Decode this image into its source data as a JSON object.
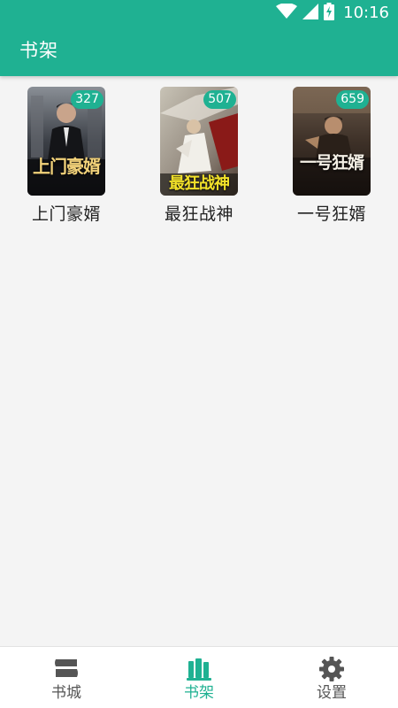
{
  "status_bar": {
    "time": "10:16",
    "icons": [
      "wifi-icon",
      "cellular-signal-icon",
      "battery-charging-icon"
    ]
  },
  "app_bar": {
    "title": "书架"
  },
  "shelf": {
    "books": [
      {
        "title": "上门豪婿",
        "badge": "327",
        "cover_text": "上门豪婿"
      },
      {
        "title": "最狂战神",
        "badge": "507",
        "cover_text": "最狂战神"
      },
      {
        "title": "一号狂婿",
        "badge": "659",
        "cover_text": "一号狂婿"
      }
    ]
  },
  "bottom_nav": {
    "items": [
      {
        "label": "书城",
        "icon": "bookstore-icon",
        "active": false
      },
      {
        "label": "书架",
        "icon": "bookshelf-icon",
        "active": true
      },
      {
        "label": "设置",
        "icon": "gear-icon",
        "active": false
      }
    ]
  },
  "colors": {
    "accent": "#1fb192",
    "background": "#f4f4f4",
    "nav_inactive": "#555555"
  }
}
